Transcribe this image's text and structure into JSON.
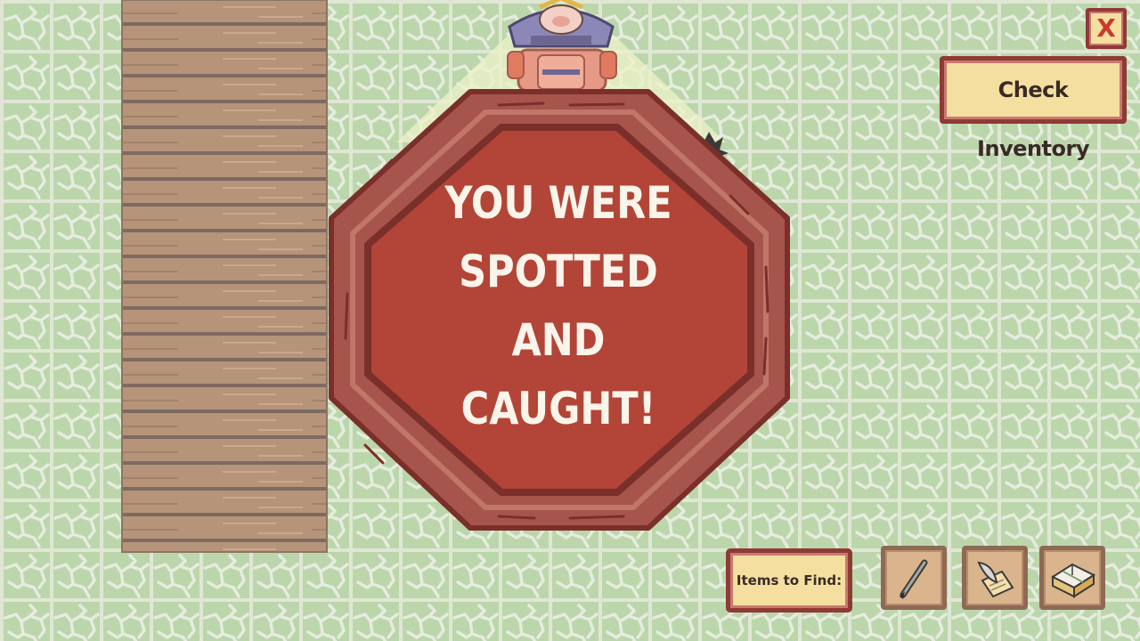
{
  "game_over": {
    "message_lines": [
      "YOU WERE",
      "SPOTTED",
      "AND",
      "CAUGHT!"
    ]
  },
  "buttons": {
    "close_label": "X",
    "inventory_label": "Check Inventory"
  },
  "items_to_find": {
    "label": "Items to Find:",
    "items": [
      {
        "icon": "ink-brush-icon"
      },
      {
        "icon": "quill-and-scroll-icon"
      },
      {
        "icon": "house-model-icon"
      }
    ]
  },
  "colors": {
    "grass": "#b8d3a7",
    "floor_planks": "#b6947a",
    "sign_red": "#b24537",
    "sign_frame": "#8f3a34",
    "panel_cream": "#f5dfa0"
  }
}
